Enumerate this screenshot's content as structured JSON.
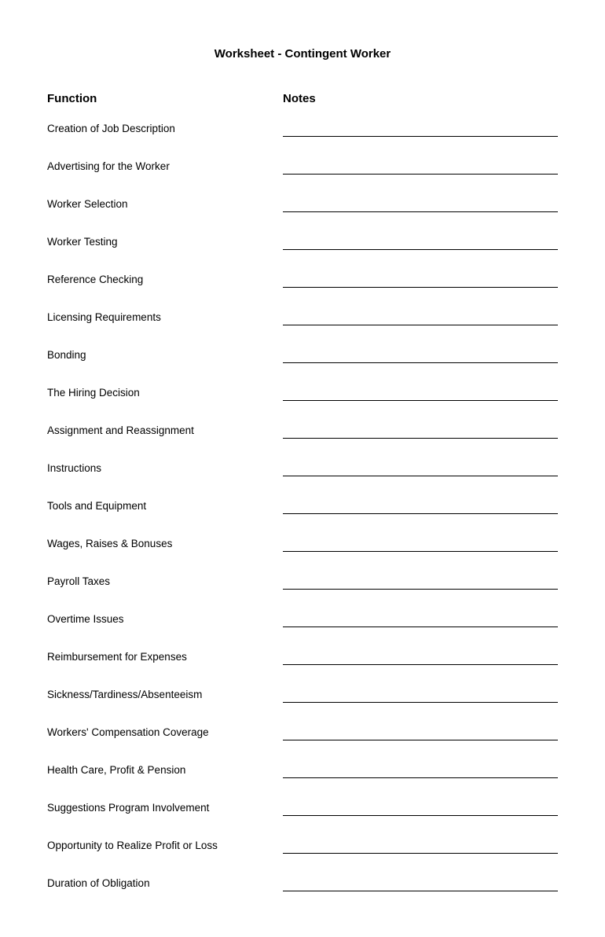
{
  "title": "Worksheet - Contingent Worker",
  "headers": {
    "function": "Function",
    "notes": "Notes"
  },
  "rows": [
    {
      "id": "creation-job-description",
      "function": "Creation of Job Description"
    },
    {
      "id": "advertising-worker",
      "function": "Advertising for the Worker"
    },
    {
      "id": "worker-selection",
      "function": "Worker Selection"
    },
    {
      "id": "worker-testing",
      "function": "Worker Testing"
    },
    {
      "id": "reference-checking",
      "function": "Reference Checking"
    },
    {
      "id": "licensing-requirements",
      "function": "Licensing Requirements"
    },
    {
      "id": "bonding",
      "function": "Bonding"
    },
    {
      "id": "hiring-decision",
      "function": "The Hiring Decision"
    },
    {
      "id": "assignment-reassignment",
      "function": "Assignment and Reassignment"
    },
    {
      "id": "instructions",
      "function": "Instructions"
    },
    {
      "id": "tools-equipment",
      "function": "Tools and Equipment"
    },
    {
      "id": "wages-raises-bonuses",
      "function": "Wages, Raises & Bonuses"
    },
    {
      "id": "payroll-taxes",
      "function": "Payroll Taxes"
    },
    {
      "id": "overtime-issues",
      "function": "Overtime Issues"
    },
    {
      "id": "reimbursement-expenses",
      "function": "Reimbursement for Expenses"
    },
    {
      "id": "sickness-tardiness-absenteeism",
      "function": "Sickness/Tardiness/Absenteeism"
    },
    {
      "id": "workers-compensation",
      "function": "Workers' Compensation Coverage"
    },
    {
      "id": "health-care-profit-pension",
      "function": "Health Care, Profit & Pension"
    },
    {
      "id": "suggestions-program",
      "function": "Suggestions Program Involvement"
    },
    {
      "id": "opportunity-realize-profit",
      "function": "Opportunity to Realize Profit or Loss"
    },
    {
      "id": "duration-obligation",
      "function": "Duration of Obligation"
    }
  ]
}
